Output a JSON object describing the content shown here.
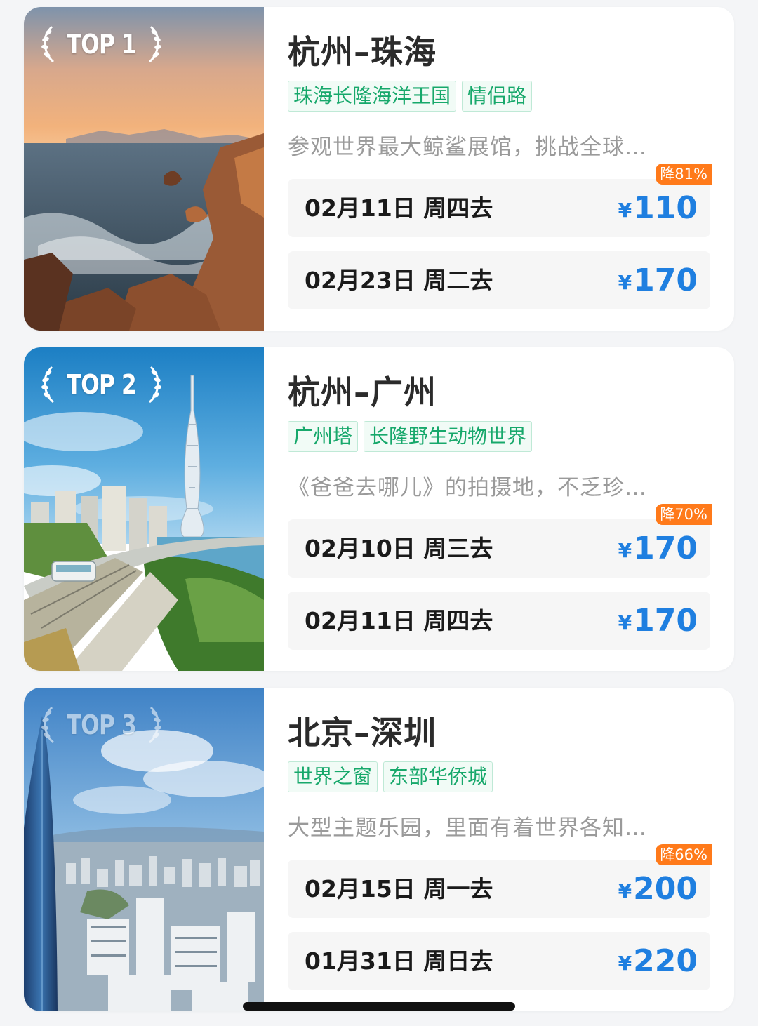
{
  "routes": [
    {
      "rank_label": "TOP 1",
      "title": "杭州–珠海",
      "tags": [
        "珠海长隆海洋王国",
        "情侣路"
      ],
      "description": "参观世界最大鲸鲨展馆，挑战全球…",
      "image_subject": "rocky-seashore-sunset",
      "trips": [
        {
          "date": "02月11日 周四去",
          "currency": "¥",
          "price": "110",
          "discount": "降81%"
        },
        {
          "date": "02月23日 周二去",
          "currency": "¥",
          "price": "170",
          "discount": ""
        }
      ]
    },
    {
      "rank_label": "TOP 2",
      "title": "杭州–广州",
      "tags": [
        "广州塔",
        "长隆野生动物世界"
      ],
      "description": "《爸爸去哪儿》的拍摄地，不乏珍…",
      "image_subject": "canton-tower-waterfront",
      "trips": [
        {
          "date": "02月10日 周三去",
          "currency": "¥",
          "price": "170",
          "discount": "降70%"
        },
        {
          "date": "02月11日 周四去",
          "currency": "¥",
          "price": "170",
          "discount": ""
        }
      ]
    },
    {
      "rank_label": "TOP 3",
      "title": "北京–深圳",
      "tags": [
        "世界之窗",
        "东部华侨城"
      ],
      "description": "大型主题乐园，里面有着世界各知…",
      "image_subject": "shenzhen-skyline",
      "trips": [
        {
          "date": "02月15日 周一去",
          "currency": "¥",
          "price": "200",
          "discount": "降66%"
        },
        {
          "date": "01月31日 周日去",
          "currency": "¥",
          "price": "220",
          "discount": ""
        }
      ]
    }
  ],
  "colors": {
    "tag_text": "#17a86b",
    "price": "#1f7fe0",
    "discount_bg": "#ff7a1a"
  }
}
